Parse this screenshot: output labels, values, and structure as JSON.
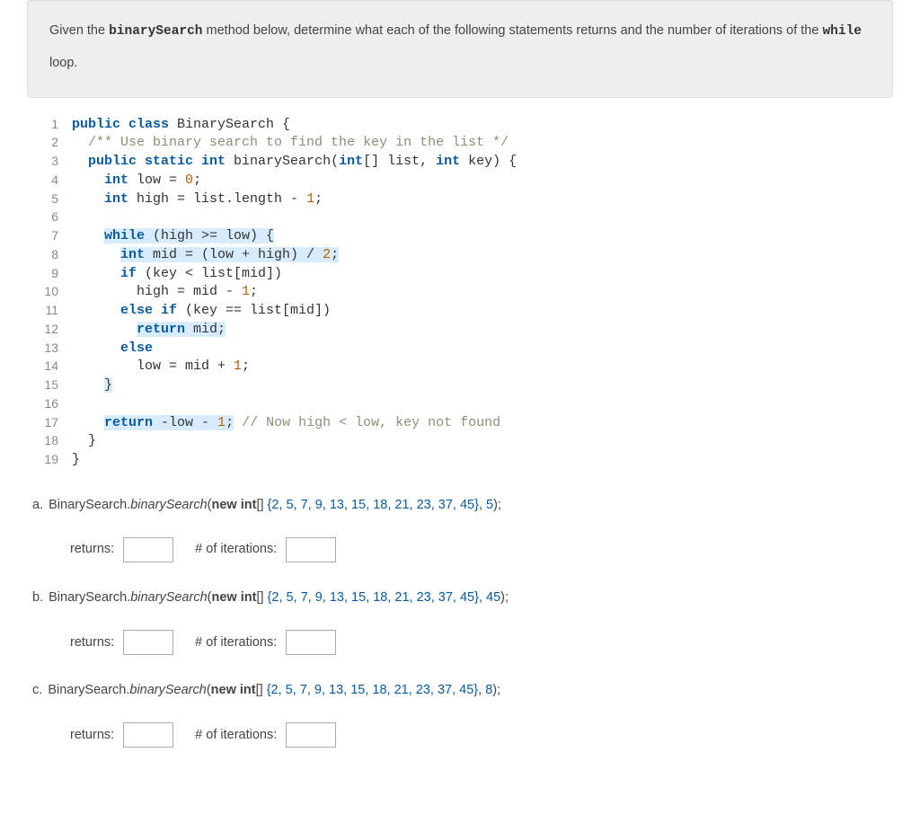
{
  "prompt": {
    "prefix": "Given the ",
    "code1": "binarySearch",
    "mid": " method below, determine what each of the following statements returns and the number of iterations of the ",
    "code2": "while",
    "suffix": " loop."
  },
  "code": {
    "lines": [
      "public class BinarySearch {",
      "  /** Use binary search to find the key in the list */",
      "  public static int binarySearch(int[] list, int key) {",
      "    int low = 0;",
      "    int high = list.length - 1;",
      "",
      "    while (high >= low) {",
      "      int mid = (low + high) / 2;",
      "      if (key < list[mid])",
      "        high = mid - 1;",
      "      else if (key == list[mid])",
      "        return mid;",
      "      else",
      "        low = mid + 1;",
      "    }",
      "",
      "    return -low - 1; // Now high < low, key not found",
      "  }",
      "}"
    ]
  },
  "questions": {
    "array_text": "{2, 5, 7, 9, 13, 15, 18, 21, 23, 37, 45}",
    "items": [
      {
        "letter": "a.",
        "key": "5"
      },
      {
        "letter": "b.",
        "key": "45"
      },
      {
        "letter": "c.",
        "key": "8"
      }
    ],
    "call_prefix": "BinarySearch.",
    "method_italic": "binarySearch",
    "new_int": "new int",
    "brackets": "[]",
    "returns_label": "returns:",
    "iter_label": "# of iterations:"
  }
}
